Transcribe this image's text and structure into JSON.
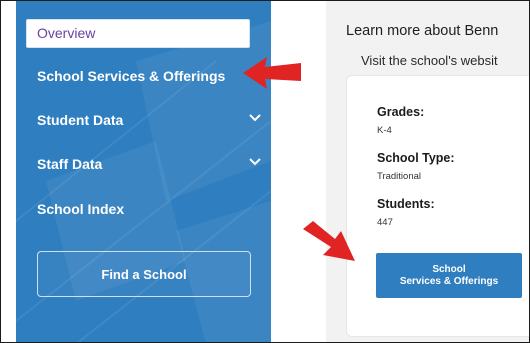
{
  "sidebar": {
    "active_item": "Overview",
    "items": [
      {
        "label": "School Services & Offerings",
        "expandable": false
      },
      {
        "label": "Student Data",
        "expandable": true
      },
      {
        "label": "Staff Data",
        "expandable": true
      },
      {
        "label": "School Index",
        "expandable": false
      }
    ],
    "find_button_label": "Find a School"
  },
  "main": {
    "learn_more": "Learn more about Benn",
    "visit_website": "Visit the school's websit",
    "grades_label": "Grades:",
    "grades_value": "K-4",
    "type_label": "School Type:",
    "type_value": "Traditional",
    "students_label": "Students:",
    "students_value": "447",
    "services_button_line1": "School",
    "services_button_line2": "Services & Offerings"
  },
  "colors": {
    "sidebar_bg": "#2f7ec0",
    "accent": "#2f7ec0",
    "arrow": "#e02424",
    "active_text": "#6b3fa0"
  },
  "icons": [
    "chevron-down-icon",
    "red-arrow-annotation"
  ]
}
